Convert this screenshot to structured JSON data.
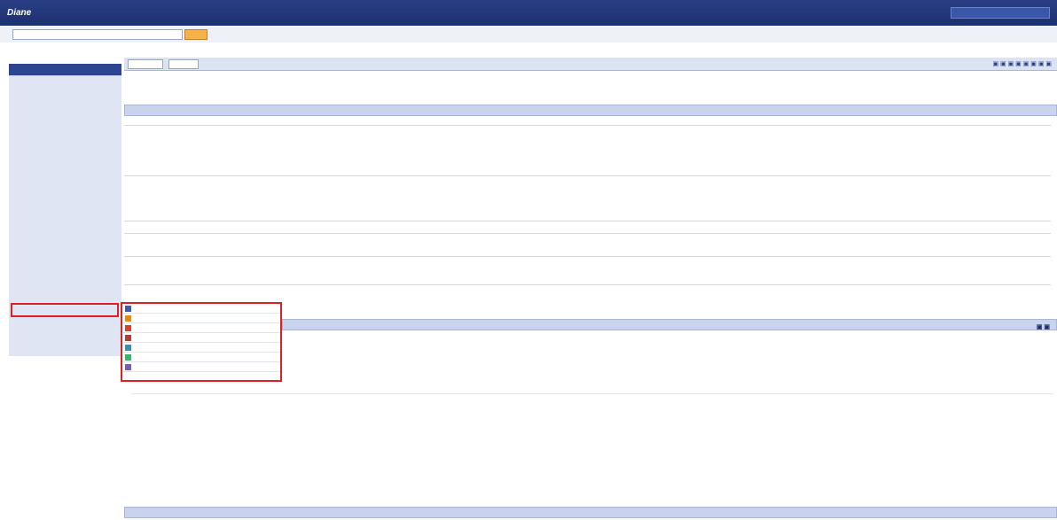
{
  "app": {
    "logo": "Diane",
    "title": "",
    "top_button": ""
  },
  "search": {
    "placeholder": "",
    "go": ""
  },
  "top_links": "",
  "breadcrumb": "",
  "sidebar": {
    "back": "",
    "items": []
  },
  "highlight": {
    "label": ""
  },
  "popup": {
    "items": [
      {
        "label": "",
        "icon": "table-icon",
        "color": "#3b5bb5"
      },
      {
        "label": "",
        "icon": "histogram-icon",
        "color": "#e28a1a"
      },
      {
        "label": "",
        "icon": "compare-histogram-icon",
        "color": "#d6412b"
      },
      {
        "label": "",
        "icon": "lorenz-curve-icon",
        "color": "#b53b3b"
      },
      {
        "label": "",
        "icon": "distribution-icon",
        "color": "#3b8fb5"
      },
      {
        "label": "",
        "icon": "evolution-icon",
        "color": "#3bb56a"
      },
      {
        "label": "",
        "icon": "quartiles-icon",
        "color": "#7a5bb5"
      }
    ]
  },
  "company": "",
  "sections": {
    "identity": "",
    "financial": "",
    "synthesis": ""
  },
  "colors": {
    "topbar": "#1c2f6e",
    "highlight": "#e02020",
    "sidebar_head": "#8696c6"
  }
}
